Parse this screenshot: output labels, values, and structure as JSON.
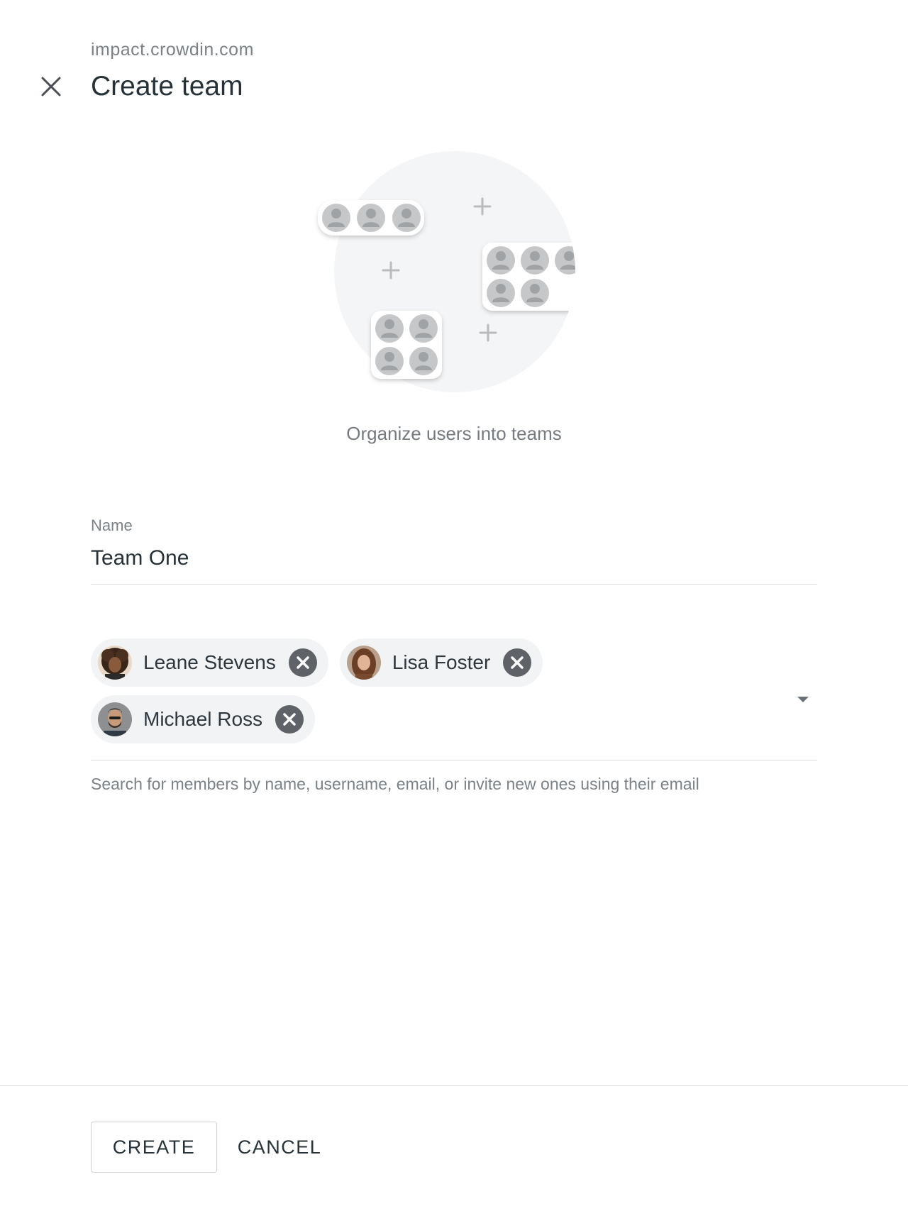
{
  "header": {
    "domain": "impact.crowdin.com",
    "title": "Create team"
  },
  "illustration": {
    "subtitle": "Organize users into teams"
  },
  "form": {
    "name_label": "Name",
    "name_value": "Team One",
    "members": [
      {
        "name": "Leane Stevens",
        "avatar": "avatar-leane-stevens"
      },
      {
        "name": "Lisa Foster",
        "avatar": "avatar-lisa-foster"
      },
      {
        "name": "Michael Ross",
        "avatar": "avatar-michael-ross"
      }
    ],
    "members_hint": "Search for members by name, username, email, or invite new ones using their email"
  },
  "footer": {
    "create_label": "CREATE",
    "cancel_label": "CANCEL"
  },
  "colors": {
    "text_primary": "#263238",
    "text_secondary": "#7b8287",
    "chip_bg": "#f2f3f4",
    "chip_remove": "#5f6368",
    "divider": "#dcdfe1",
    "illustration_bg": "#f4f5f6"
  }
}
